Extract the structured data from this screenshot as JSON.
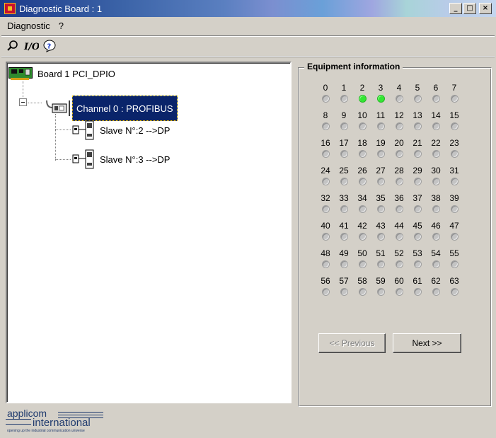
{
  "window": {
    "title": "Diagnostic Board : 1",
    "controls": [
      "_",
      "□",
      "×"
    ]
  },
  "menu": [
    {
      "label": "Diagnostic"
    },
    {
      "label": "?"
    }
  ],
  "toolbar": {
    "io_label": "I/O"
  },
  "tree": {
    "board": "Board 1 PCI_DPIO",
    "channel": "Channel 0 : PROFIBUS",
    "slaves": [
      "Slave N°:2 -->DP",
      "Slave N°:3 -->DP"
    ]
  },
  "equipment": {
    "title": "Equipment information",
    "rows": [
      {
        "nums": [
          "0",
          "1",
          "2",
          "3",
          "4",
          "5",
          "6",
          "7"
        ],
        "states": [
          false,
          false,
          true,
          true,
          false,
          false,
          false,
          false
        ]
      },
      {
        "nums": [
          "8",
          "9",
          "10",
          "11",
          "12",
          "13",
          "14",
          "15"
        ],
        "states": [
          false,
          false,
          false,
          false,
          false,
          false,
          false,
          false
        ]
      },
      {
        "nums": [
          "16",
          "17",
          "18",
          "19",
          "20",
          "21",
          "22",
          "23"
        ],
        "states": [
          false,
          false,
          false,
          false,
          false,
          false,
          false,
          false
        ]
      },
      {
        "nums": [
          "24",
          "25",
          "26",
          "27",
          "28",
          "29",
          "30",
          "31"
        ],
        "states": [
          false,
          false,
          false,
          false,
          false,
          false,
          false,
          false
        ]
      },
      {
        "nums": [
          "32",
          "33",
          "34",
          "35",
          "36",
          "37",
          "38",
          "39"
        ],
        "states": [
          false,
          false,
          false,
          false,
          false,
          false,
          false,
          false
        ]
      },
      {
        "nums": [
          "40",
          "41",
          "42",
          "43",
          "44",
          "45",
          "46",
          "47"
        ],
        "states": [
          false,
          false,
          false,
          false,
          false,
          false,
          false,
          false
        ]
      },
      {
        "nums": [
          "48",
          "49",
          "50",
          "51",
          "52",
          "53",
          "54",
          "55"
        ],
        "states": [
          false,
          false,
          false,
          false,
          false,
          false,
          false,
          false
        ]
      },
      {
        "nums": [
          "56",
          "57",
          "58",
          "59",
          "60",
          "61",
          "62",
          "63"
        ],
        "states": [
          false,
          false,
          false,
          false,
          false,
          false,
          false,
          false
        ]
      }
    ],
    "previous_label": "<< Previous",
    "next_label": "Next >>"
  },
  "logo": {
    "line1": "applicom",
    "line2": "international",
    "tagline": "opening up the industrial communication universe"
  },
  "colors": {
    "selection": "#0a246a",
    "led_on": "#33e633",
    "led_off": "#c4c4c4"
  }
}
